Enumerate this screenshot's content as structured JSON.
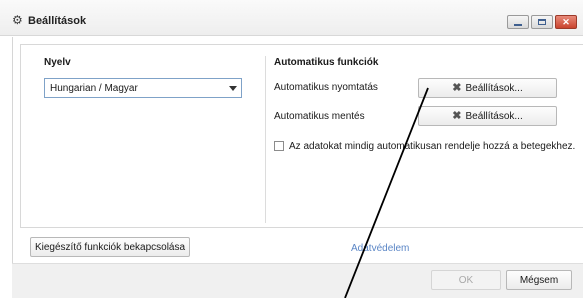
{
  "window": {
    "title": "Beállítások"
  },
  "language": {
    "heading": "Nyelv",
    "selected": "Hungarian / Magyar"
  },
  "auto": {
    "heading": "Automatikus funkciók",
    "print_label": "Automatikus nyomtatás",
    "save_label": "Automatikus mentés",
    "settings_button": "Beállítások...",
    "checkbox_label": "Az adatokat mindig automatikusan rendelje hozzá a betegekhez.",
    "checkbox_checked": false
  },
  "footer": {
    "addons_button": "Kiegészítő funkciók bekapcsolása",
    "privacy_link": "Adatvédelem",
    "ok_button": "OK",
    "cancel_button": "Mégsem"
  },
  "icons": {
    "title": "gear-icon",
    "settings": "x-icon"
  }
}
